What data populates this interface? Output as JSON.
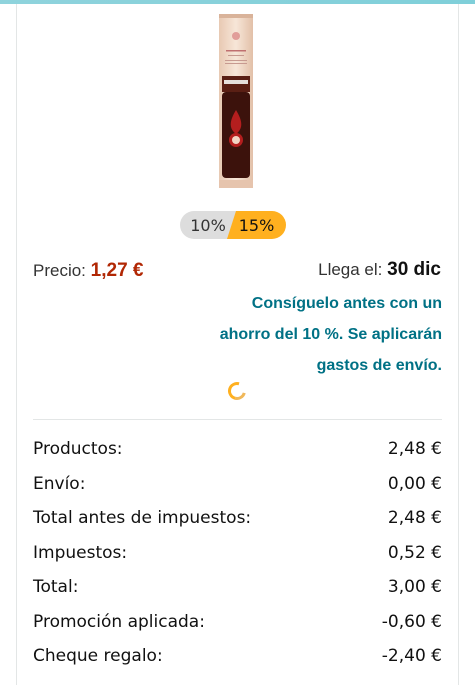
{
  "product": {
    "image_alt": "Bolero drink sachet",
    "image_icon": "product-sachet-image"
  },
  "discount": {
    "options": [
      "10%",
      "15%"
    ],
    "selected": "15%"
  },
  "price": {
    "label": "Precio:",
    "amount": "1,27 €"
  },
  "delivery": {
    "label": "Llega el:",
    "date": "30 dic"
  },
  "promo": {
    "message": "Consíguelo antes con un ahorro del 10 %. Se aplicarán gastos de envío."
  },
  "summary": {
    "rows": [
      {
        "label": "Productos:",
        "value": "2,48 €"
      },
      {
        "label": "Envío:",
        "value": "0,00 €"
      },
      {
        "label": "Total antes de impuestos:",
        "value": "2,48 €"
      },
      {
        "label": "Impuestos:",
        "value": "0,52 €"
      },
      {
        "label": "Total:",
        "value": "3,00 €"
      },
      {
        "label": "Promoción aplicada:",
        "value": "-0,60 €"
      },
      {
        "label": "Cheque regalo:",
        "value": "-2,40 €"
      }
    ]
  },
  "colors": {
    "price": "#b12704",
    "link": "#007185",
    "selected_discount": "#ffb01f",
    "unselected_discount": "#dddddd"
  }
}
